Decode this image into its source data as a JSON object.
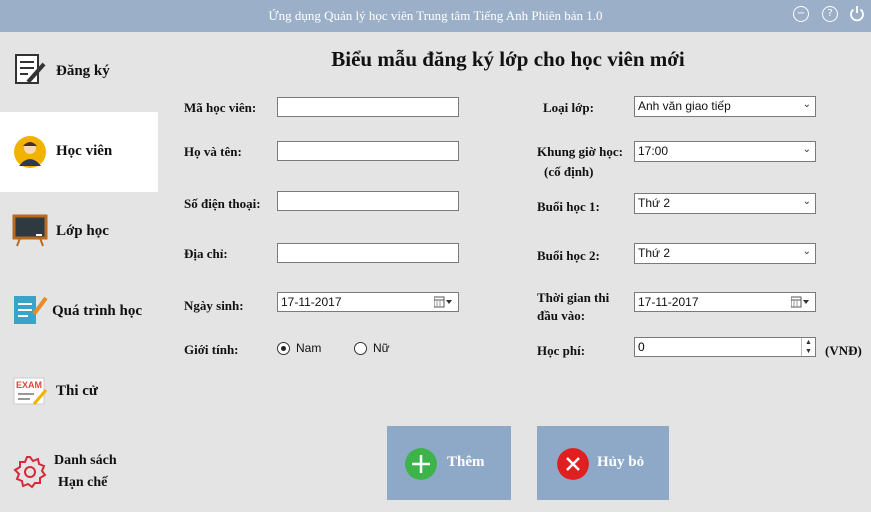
{
  "window": {
    "title": "Ứng dụng Quản lý học viên Trung tâm Tiếng Anh Phiên bản 1.0"
  },
  "sidebar": {
    "items": [
      {
        "label": "Đăng ký",
        "icon": "register-icon"
      },
      {
        "label": "Học viên",
        "icon": "student-icon",
        "active": true
      },
      {
        "label": "Lớp học",
        "icon": "blackboard-icon"
      },
      {
        "label": "Quá trình học",
        "icon": "notebook-icon"
      },
      {
        "label": "Thi cử",
        "icon": "exam-icon"
      },
      {
        "label_line1": "Danh sách",
        "label_line2": "Hạn chế",
        "icon": "gear-icon"
      }
    ]
  },
  "form": {
    "title": "Biểu mẫu đăng ký lớp cho học viên mới",
    "left": {
      "student_id_label": "Mã học viên:",
      "student_id_value": "",
      "full_name_label": "Họ và tên:",
      "full_name_value": "",
      "phone_label": "Số điện thoại:",
      "phone_value": "",
      "address_label": "Địa chỉ:",
      "address_value": "",
      "dob_label": "Ngày sinh:",
      "dob_value": "17-11-2017",
      "gender_label": "Giới tính:",
      "gender_male": "Nam",
      "gender_female": "Nữ",
      "gender_selected": "Nam"
    },
    "right": {
      "class_type_label": "Loại lớp:",
      "class_type_value": "Anh văn giao tiếp",
      "time_label_line1": "Khung giờ học:",
      "time_label_line2": "(cố định)",
      "time_value": "17:00",
      "session1_label": "Buổi học 1:",
      "session1_value": "Thứ 2",
      "session2_label": "Buổi học 2:",
      "session2_value": "Thứ 2",
      "entrance_label_line1": "Thời gian thi",
      "entrance_label_line2": "đầu vào:",
      "entrance_value": "17-11-2017",
      "fee_label": "Học phí:",
      "fee_value": "0",
      "fee_unit": "(VNĐ)"
    },
    "buttons": {
      "add": "Thêm",
      "cancel": "Hủy bỏ"
    }
  },
  "colors": {
    "titlebar": "#9bb0c8",
    "button": "#8ea8c8",
    "add_icon": "#3cb44a",
    "cancel_icon": "#e02020"
  }
}
